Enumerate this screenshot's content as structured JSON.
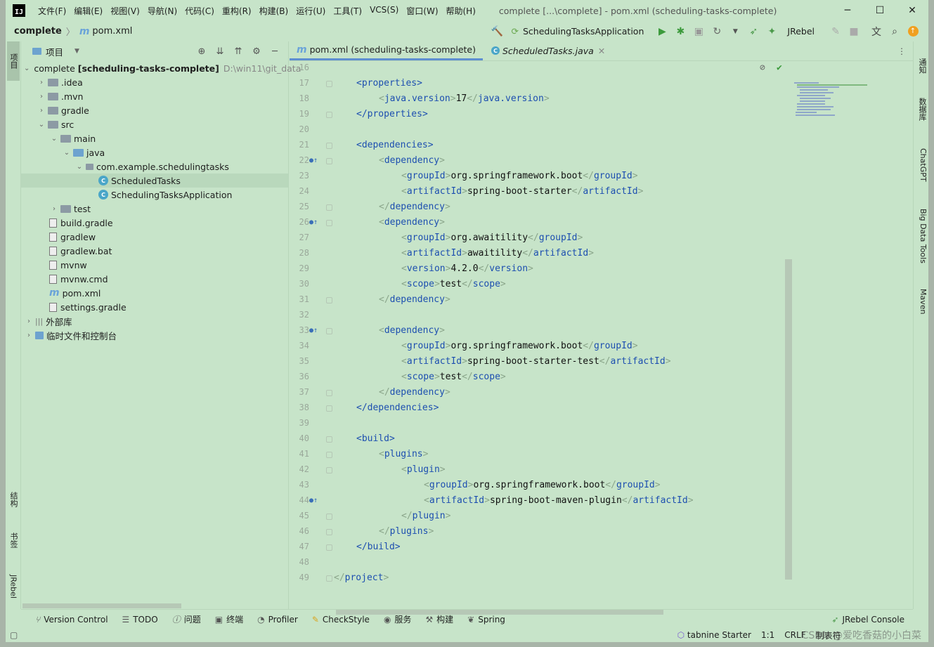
{
  "menu": [
    "文件(F)",
    "编辑(E)",
    "视图(V)",
    "导航(N)",
    "代码(C)",
    "重构(R)",
    "构建(B)",
    "运行(U)",
    "工具(T)",
    "VCS(S)",
    "窗口(W)",
    "帮助(H)"
  ],
  "window_title": "complete [...\\complete] - pom.xml (scheduling-tasks-complete)",
  "breadcrumb": {
    "project": "complete",
    "file": "pom.xml"
  },
  "run_config": "SchedulingTasksApplication",
  "jrebel_label": "JRebel",
  "project_panel": {
    "title": "项目"
  },
  "tree": [
    {
      "label": "complete",
      "bold": "[scheduling-tasks-complete]",
      "path": "D:\\win11\\git_data"
    },
    {
      "label": ".idea"
    },
    {
      "label": ".mvn"
    },
    {
      "label": "gradle"
    },
    {
      "label": "src"
    },
    {
      "label": "main"
    },
    {
      "label": "java"
    },
    {
      "label": "com.example.schedulingtasks"
    },
    {
      "label": "ScheduledTasks"
    },
    {
      "label": "SchedulingTasksApplication"
    },
    {
      "label": "test"
    },
    {
      "label": "build.gradle"
    },
    {
      "label": "gradlew"
    },
    {
      "label": "gradlew.bat"
    },
    {
      "label": "mvnw"
    },
    {
      "label": "mvnw.cmd"
    },
    {
      "label": "pom.xml"
    },
    {
      "label": "settings.gradle"
    },
    {
      "label": "外部库"
    },
    {
      "label": "临时文件和控制台"
    }
  ],
  "tabs": [
    {
      "label": "pom.xml (scheduling-tasks-complete)"
    },
    {
      "label": "ScheduledTasks.java"
    }
  ],
  "left_strip": {
    "project": "项目",
    "structure": "结构",
    "bookmarks": "书签",
    "jrebel": "JRebel"
  },
  "right_strip": {
    "notifications": "通知",
    "database": "数据库",
    "chatgpt": "ChatGPT",
    "bigdata": "Big Data Tools",
    "maven": "Maven"
  },
  "code": {
    "line_numbers": [
      "16",
      "17",
      "18",
      "19",
      "20",
      "21",
      "22",
      "23",
      "24",
      "25",
      "26",
      "27",
      "28",
      "29",
      "30",
      "31",
      "32",
      "33",
      "34",
      "35",
      "36",
      "37",
      "38",
      "39",
      "40",
      "41",
      "42",
      "43",
      "44",
      "45",
      "46",
      "47",
      "48",
      "49"
    ],
    "l17": [
      "<",
      "properties",
      ">"
    ],
    "l18": [
      "<",
      "java.version",
      ">",
      "17",
      "</",
      "java.version",
      ">"
    ],
    "l19": [
      "</",
      "properties",
      ">"
    ],
    "l21": [
      "<",
      "dependencies",
      ">"
    ],
    "l22": [
      "<",
      "dependency",
      ">"
    ],
    "l23": [
      "<",
      "groupId",
      ">",
      "org.springframework.boot",
      "</",
      "groupId",
      ">"
    ],
    "l24": [
      "<",
      "artifactId",
      ">",
      "spring-boot-starter",
      "</",
      "artifactId",
      ">"
    ],
    "l25": [
      "</",
      "dependency",
      ">"
    ],
    "l26": [
      "<",
      "dependency",
      ">"
    ],
    "l27": [
      "<",
      "groupId",
      ">",
      "org.awaitility",
      "</",
      "groupId",
      ">"
    ],
    "l28": [
      "<",
      "artifactId",
      ">",
      "awaitility",
      "</",
      "artifactId",
      ">"
    ],
    "l29": [
      "<",
      "version",
      ">",
      "4.2.0",
      "</",
      "version",
      ">"
    ],
    "l30": [
      "<",
      "scope",
      ">",
      "test",
      "</",
      "scope",
      ">"
    ],
    "l31": [
      "</",
      "dependency",
      ">"
    ],
    "l33": [
      "<",
      "dependency",
      ">"
    ],
    "l34": [
      "<",
      "groupId",
      ">",
      "org.springframework.boot",
      "</",
      "groupId",
      ">"
    ],
    "l35": [
      "<",
      "artifactId",
      ">",
      "spring-boot-starter-test",
      "</",
      "artifactId",
      ">"
    ],
    "l36": [
      "<",
      "scope",
      ">",
      "test",
      "</",
      "scope",
      ">"
    ],
    "l37": [
      "</",
      "dependency",
      ">"
    ],
    "l38": [
      "</",
      "dependencies",
      ">"
    ],
    "l40": [
      "<",
      "build",
      ">"
    ],
    "l41": [
      "<",
      "plugins",
      ">"
    ],
    "l42": [
      "<",
      "plugin",
      ">"
    ],
    "l43": [
      "<",
      "groupId",
      ">",
      "org.springframework.boot",
      "</",
      "groupId",
      ">"
    ],
    "l44": [
      "<",
      "artifactId",
      ">",
      "spring-boot-maven-plugin",
      "</",
      "artifactId",
      ">"
    ],
    "l45": [
      "</",
      "plugin",
      ">"
    ],
    "l46": [
      "</",
      "plugins",
      ">"
    ],
    "l47": [
      "</",
      "build",
      ">"
    ],
    "l49": [
      "</",
      "project",
      ">"
    ]
  },
  "bottom_tools": [
    "Version Control",
    "TODO",
    "问题",
    "终端",
    "Profiler",
    "CheckStyle",
    "服务",
    "构建",
    "Spring"
  ],
  "jrebel_console": "JRebel Console",
  "status": {
    "tabnine": "tabnine Starter",
    "position": "1:1",
    "line_sep": "CRLF",
    "extra": "制表符"
  },
  "watermark": "CSDN @爱吃香菇的小白菜",
  "colors": {
    "background": "#c7e4c9",
    "tag": "#1d4fb0",
    "bracket": "#8aa58a",
    "accent": "#5e8fd1"
  }
}
